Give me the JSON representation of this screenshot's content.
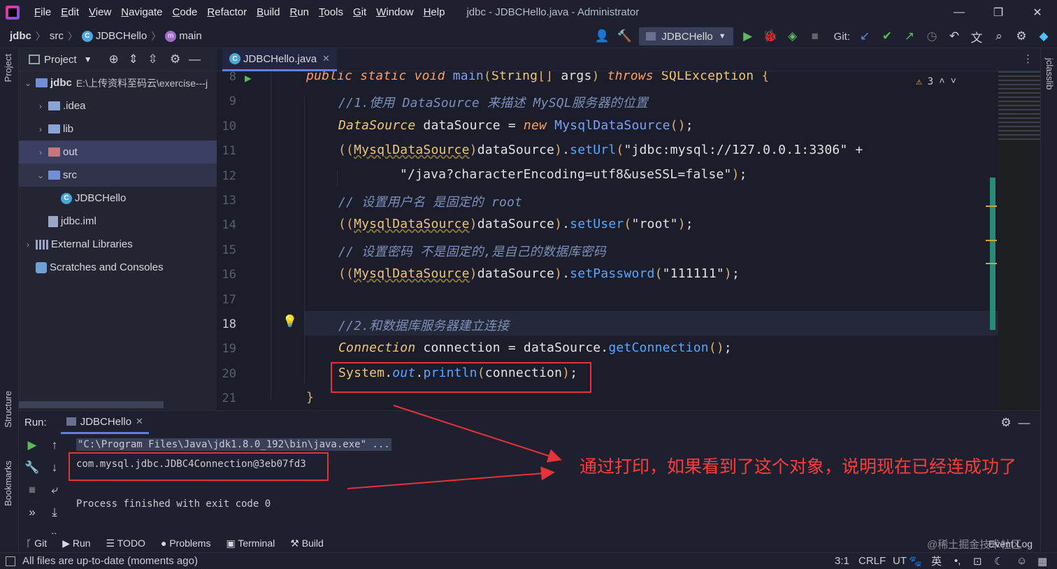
{
  "window": {
    "title": "jdbc - JDBCHello.java - Administrator",
    "menu": [
      {
        "label": "File",
        "mn": "F",
        "rest": "ile"
      },
      {
        "label": "Edit",
        "mn": "E",
        "rest": "dit"
      },
      {
        "label": "View",
        "mn": "V",
        "rest": "iew"
      },
      {
        "label": "Navigate",
        "mn": "N",
        "rest": "avigate"
      },
      {
        "label": "Code",
        "mn": "C",
        "rest": "ode"
      },
      {
        "label": "Refactor",
        "mn": "R",
        "rest": "efactor"
      },
      {
        "label": "Build",
        "mn": "B",
        "rest": "uild"
      },
      {
        "label": "Run",
        "mn": "R",
        "rest": "un"
      },
      {
        "label": "Tools",
        "mn": "T",
        "rest": "ools"
      },
      {
        "label": "Git",
        "mn": "G",
        "rest": "it"
      },
      {
        "label": "Window",
        "mn": "W",
        "rest": "indow"
      },
      {
        "label": "Help",
        "mn": "H",
        "rest": "elp"
      }
    ]
  },
  "nav": {
    "crumbs": [
      "jdbc",
      "src",
      "JDBCHello",
      "main"
    ],
    "run_config": "JDBCHello",
    "git_label": "Git:"
  },
  "project": {
    "header": "Project",
    "tree": [
      {
        "label": "jdbc",
        "path": "E:\\上传资料至码云\\exercise---j",
        "indent": 0,
        "arrow": "⌄",
        "icon": "folder-blue"
      },
      {
        "label": ".idea",
        "indent": 1,
        "arrow": "›",
        "icon": "folder"
      },
      {
        "label": "lib",
        "indent": 1,
        "arrow": "›",
        "icon": "folder"
      },
      {
        "label": "out",
        "indent": 1,
        "arrow": "›",
        "icon": "folder-red"
      },
      {
        "label": "src",
        "indent": 1,
        "arrow": "⌄",
        "icon": "folder-blue"
      },
      {
        "label": "JDBCHello",
        "indent": 2,
        "arrow": "",
        "icon": "class"
      },
      {
        "label": "jdbc.iml",
        "indent": 1,
        "arrow": "",
        "icon": "iml"
      },
      {
        "label": "External Libraries",
        "indent": 0,
        "arrow": "›",
        "icon": "lib"
      },
      {
        "label": "Scratches and Consoles",
        "indent": 0,
        "arrow": "",
        "icon": "scratch"
      }
    ]
  },
  "editor": {
    "tab": "JDBCHello.java",
    "warnings": "3",
    "line_numbers": [
      "8",
      "9",
      "10",
      "11",
      "12",
      "13",
      "14",
      "15",
      "16",
      "17",
      "18",
      "19",
      "20",
      "21"
    ],
    "code": {
      "l8_public": "public",
      "l8_static": "static",
      "l8_void": "void",
      "l8_main": "main",
      "l8_string": "String",
      "l8_args": "args",
      "l8_throws": "throws",
      "l8_exc": "SQLException",
      "l9": "//1.使用 DataSource 来描述 MySQL服务器的位置",
      "l10_type": "DataSource",
      "l10_var": "dataSource",
      "l10_new": "new",
      "l10_cls": "MysqlDataSource",
      "l11_cast": "MysqlDataSource",
      "l11_var": "dataSource",
      "l11_m": "setUrl",
      "l11_s": "\"jdbc:mysql://127.0.0.1:3306\"",
      "l12_s": "\"/java?characterEncoding=utf8&useSSL=false\"",
      "l13": "// 设置用户名 是固定的 root",
      "l14_cast": "MysqlDataSource",
      "l14_var": "dataSource",
      "l14_m": "setUser",
      "l14_s": "\"root\"",
      "l15": "// 设置密码 不是固定的,是自己的数据库密码",
      "l16_cast": "MysqlDataSource",
      "l16_var": "dataSource",
      "l16_m": "setPassword",
      "l16_s": "\"111111\"",
      "l18": "//2.和数据库服务器建立连接",
      "l19_type": "Connection",
      "l19_var": "connection",
      "l19_src": "dataSource",
      "l19_m": "getConnection",
      "l20_sys": "System",
      "l20_out": "out",
      "l20_m": "println",
      "l20_arg": "connection"
    }
  },
  "run": {
    "label": "Run:",
    "tab": "JDBCHello",
    "lines": [
      "\"C:\\Program Files\\Java\\jdk1.8.0_192\\bin\\java.exe\" ...",
      "com.mysql.jdbc.JDBC4Connection@3eb07fd3",
      "Process finished with exit code 0"
    ]
  },
  "tool_tabs": [
    "Git",
    "Run",
    "TODO",
    "Problems",
    "Terminal",
    "Build"
  ],
  "status": {
    "message": "All files are up-to-date (moments ago)",
    "position": "3:1",
    "line_sep": "CRLF",
    "encoding": "UT",
    "event_log": "Event Log",
    "watermark": "@稀土掘金技术社区",
    "ime": "英"
  },
  "stripes": {
    "left": [
      "Project",
      "Structure",
      "Bookmarks"
    ],
    "right": "jclasslib"
  },
  "annotation": "通过打印，如果看到了这个对象，说明现在已经连成功了",
  "colors": {
    "accent": "#5d7fe8",
    "annotation": "#e5333a"
  }
}
